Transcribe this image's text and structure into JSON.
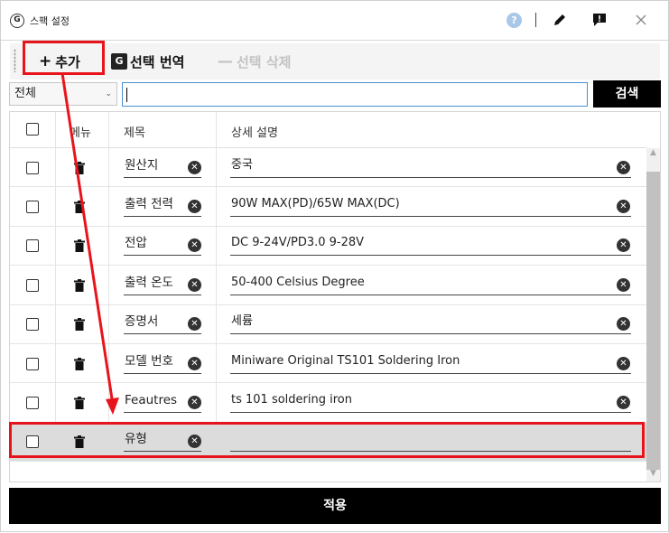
{
  "window": {
    "title": "스팩 설정"
  },
  "toolbar": {
    "add_label": "추가",
    "translate_label": "선택 번역",
    "delete_label": "선택 삭제"
  },
  "search": {
    "filter_value": "전체",
    "query_value": "",
    "button_label": "검색"
  },
  "table": {
    "headers": {
      "menu": "메뉴",
      "title": "제목",
      "description": "상세 설명"
    },
    "rows": [
      {
        "title": "원산지",
        "description": "중국"
      },
      {
        "title": "출력 전력",
        "description": "90W MAX(PD)/65W MAX(DC)"
      },
      {
        "title": "전압",
        "description": "DC 9-24V/PD3.0 9-28V"
      },
      {
        "title": "출력 온도",
        "description": "50-400 Celsius Degree"
      },
      {
        "title": "증명서",
        "description": "세륨"
      },
      {
        "title": "모델 번호",
        "description": "Miniware Original TS101 Soldering Iron"
      },
      {
        "title": "Feautres",
        "description": "ts 101 soldering iron"
      },
      {
        "title": "유형",
        "description": ""
      }
    ]
  },
  "apply": {
    "label": "적용"
  },
  "colors": {
    "annotation": "#e8141c",
    "accent": "#4a8fd1"
  },
  "icons": [
    "app-icon",
    "help-icon",
    "edit-icon",
    "report-icon",
    "close-icon",
    "plus-icon",
    "translate-icon",
    "minus-icon",
    "trash-icon",
    "clear-icon"
  ]
}
